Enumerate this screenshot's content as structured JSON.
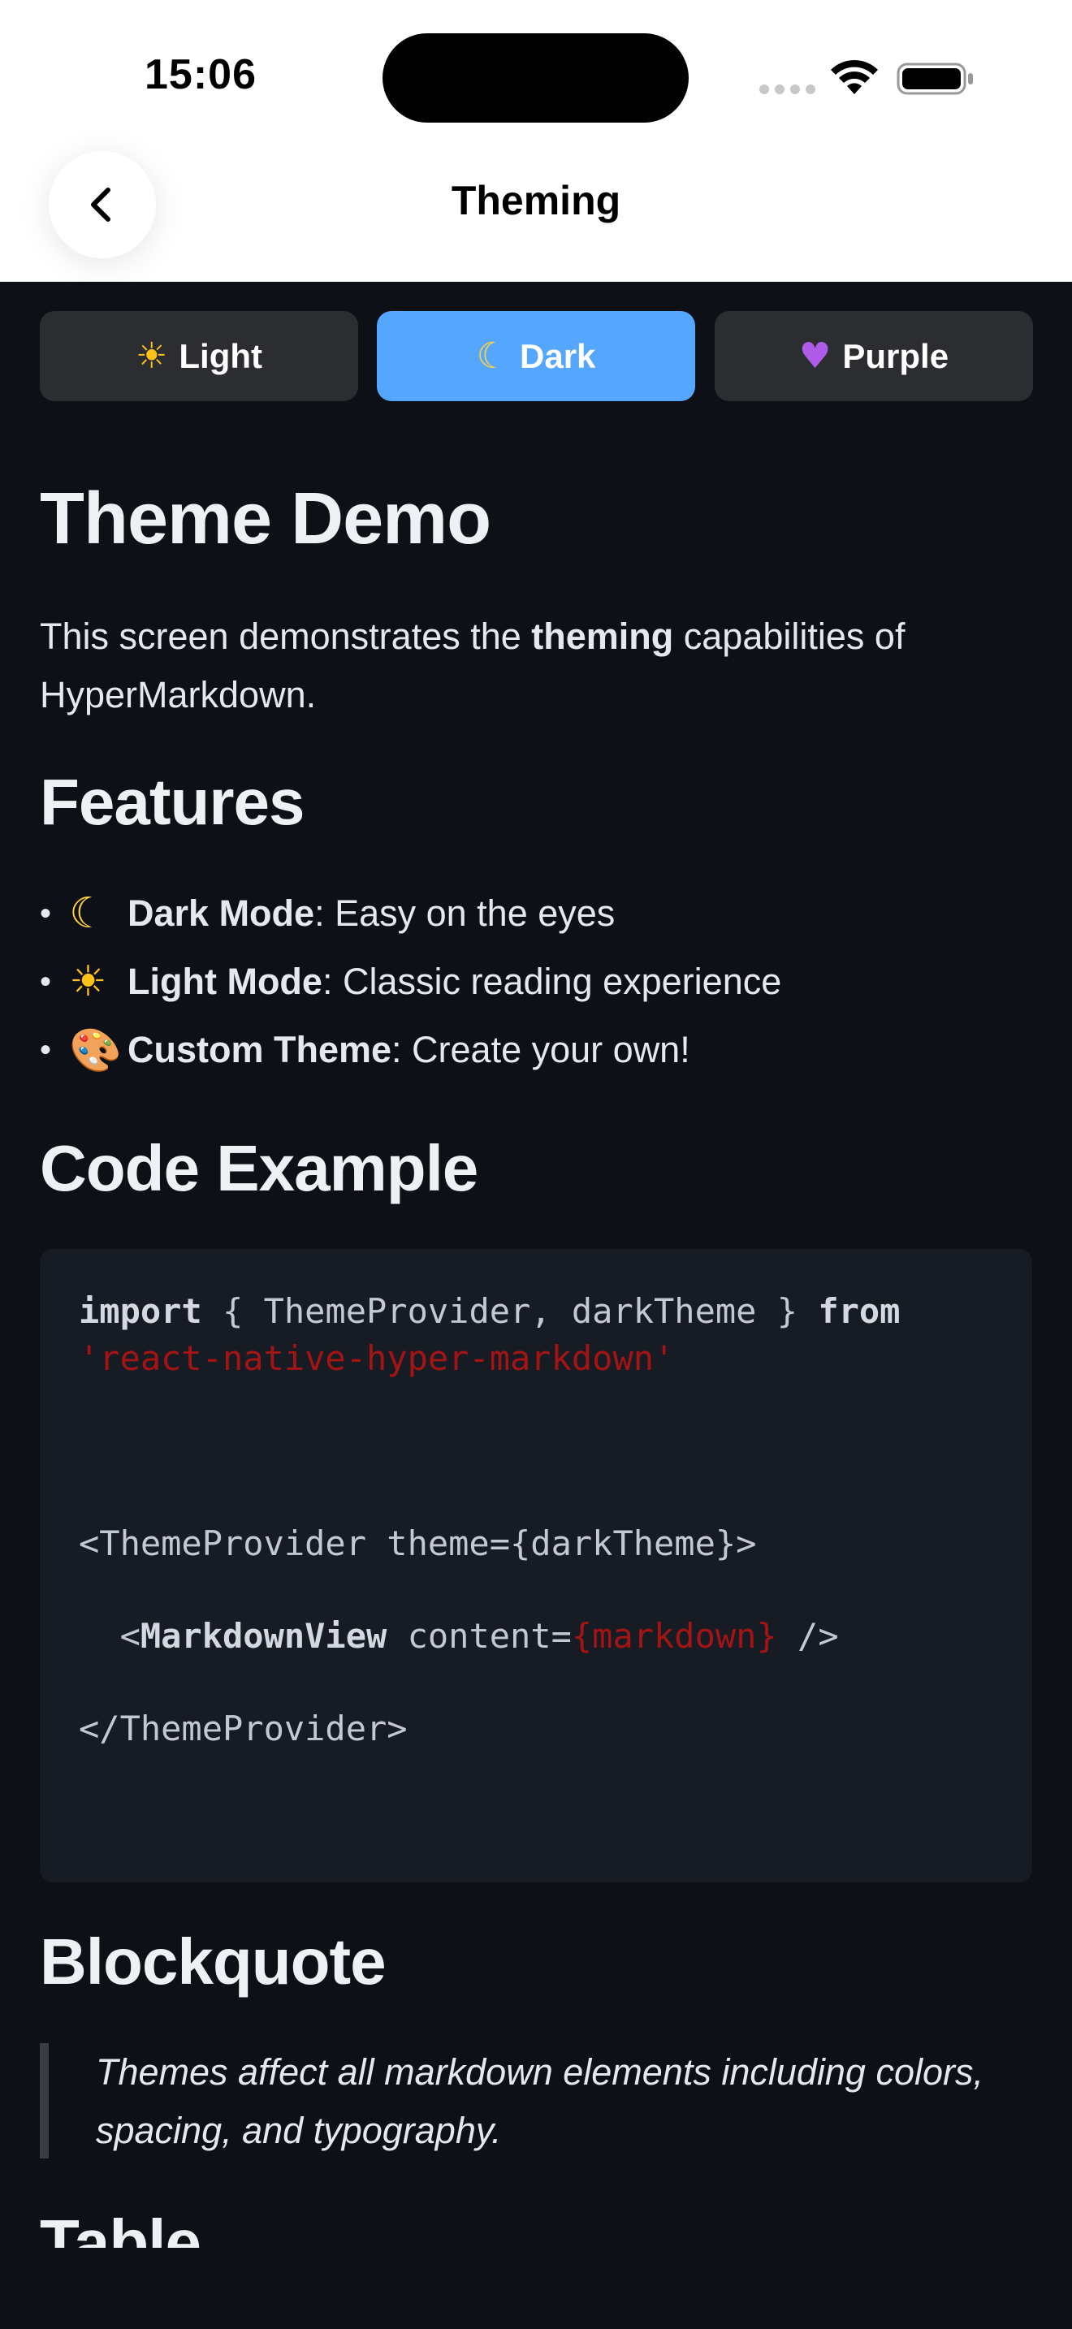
{
  "status_bar": {
    "time": "15:06"
  },
  "nav": {
    "title": "Theming",
    "back_icon": "chevron-left-icon"
  },
  "theme_tabs": [
    {
      "label": "Light",
      "icon": "sun-icon",
      "glyph": "☀",
      "active": false
    },
    {
      "label": "Dark",
      "icon": "moon-icon",
      "glyph": "☾",
      "active": true
    },
    {
      "label": "Purple",
      "icon": "purple-heart-icon",
      "glyph": "♥",
      "active": false
    }
  ],
  "content": {
    "title": "Theme Demo",
    "intro": {
      "before": "This screen demonstrates the ",
      "bold": "theming",
      "after": " capabilities of HyperMarkdown."
    },
    "features_heading": "Features",
    "features": [
      {
        "icon": "moon-icon",
        "glyph": "☾",
        "label": "Dark Mode",
        "text": ": Easy on the eyes"
      },
      {
        "icon": "sun-icon",
        "glyph": "☀",
        "label": "Light Mode",
        "text": ": Classic reading experience"
      },
      {
        "icon": "palette-icon",
        "glyph": "🎨",
        "label": "Custom Theme",
        "text": ": Create your own!"
      }
    ],
    "code_heading": "Code Example",
    "code": {
      "line1_kw1": "import",
      "line1_mid": " { ThemeProvider, darkTheme } ",
      "line1_kw2": "from",
      "line2_str": "'react-native-hyper-markdown'",
      "line3": "<ThemeProvider theme={darkTheme}>",
      "line4_open": "  <",
      "line4_tag": "MarkdownView",
      "line4_attr": " content=",
      "line4_expr": "{markdown}",
      "line4_close": " />",
      "line5": "</ThemeProvider>"
    },
    "blockquote_heading": "Blockquote",
    "blockquote_text": "Themes affect all markdown elements including colors, spacing, and typography.",
    "table_heading": "Table"
  },
  "colors": {
    "background": "#0d1017",
    "tab_inactive": "#2c2d31",
    "tab_active": "#55a6ff",
    "code_background": "#171b23",
    "string": "#a31515"
  }
}
